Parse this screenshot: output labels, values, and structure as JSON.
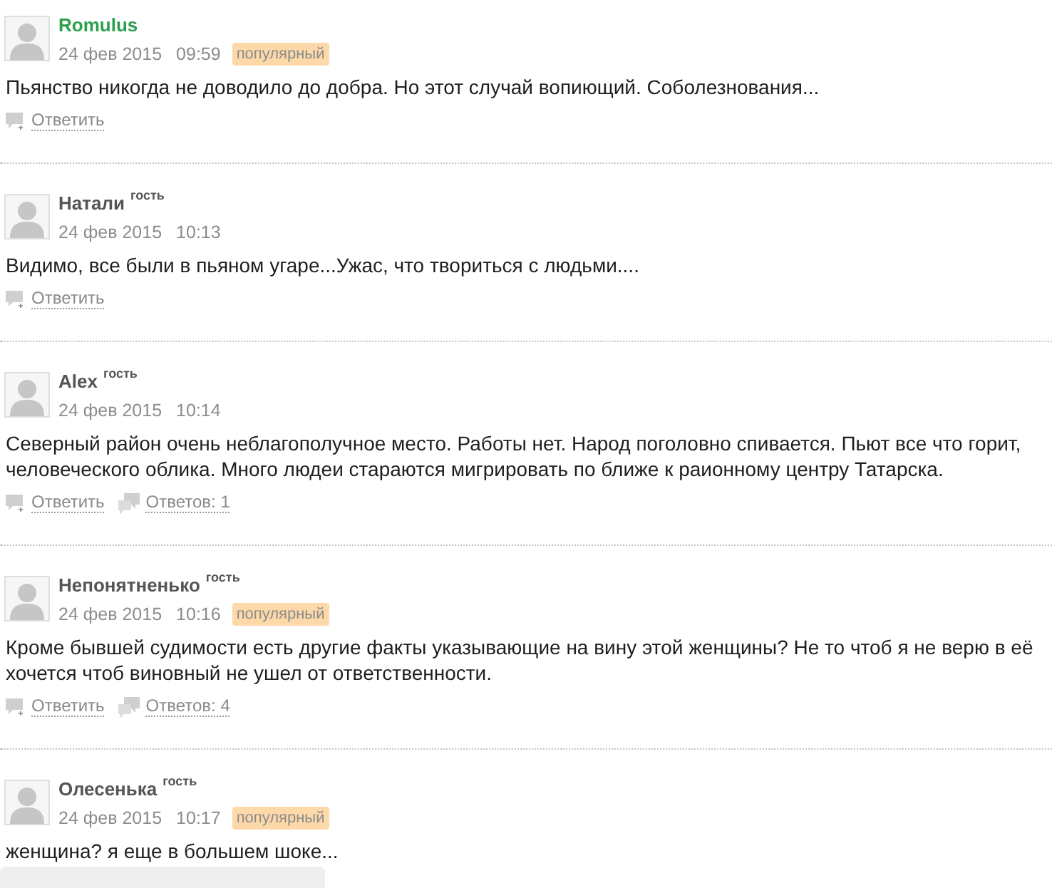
{
  "comments": [
    {
      "author": {
        "name": "Romulus",
        "kind": "member"
      },
      "date": "24 фев 2015",
      "time": "09:59",
      "badge": "популярный",
      "lines": [
        "Пьянство никогда не доводило до добра. Но этот случай вопиющий. Соболезнования..."
      ],
      "actions": [
        {
          "kind": "reply",
          "label": "Ответить"
        }
      ]
    },
    {
      "author": {
        "name": "Натали",
        "kind": "guest",
        "guest_label": "гость"
      },
      "date": "24 фев 2015",
      "time": "10:13",
      "lines": [
        "Видимо, все были в пьяном угаре...Ужас, что твориться с людьми...."
      ],
      "actions": [
        {
          "kind": "reply",
          "label": "Ответить"
        }
      ]
    },
    {
      "author": {
        "name": "Alex",
        "kind": "guest",
        "guest_label": "гость"
      },
      "date": "24 фев 2015",
      "time": "10:14",
      "lines": [
        "Северный район очень неблагополучное место. Работы нет. Народ поголовно спивается. Пьют все что горит,",
        "человеческого облика. Много людеи стараются мигрировать по ближе к раионному центру Татарска."
      ],
      "actions": [
        {
          "kind": "reply",
          "label": "Ответить"
        },
        {
          "kind": "replies",
          "label": "Ответов: 1"
        }
      ]
    },
    {
      "author": {
        "name": "Непонятненько",
        "kind": "guest",
        "guest_label": "гость"
      },
      "date": "24 фев 2015",
      "time": "10:16",
      "badge": "популярный",
      "lines": [
        "Кроме бывшей судимости есть другие факты указывающие на вину этой женщины? Не то чтоб я не верю в её",
        "хочется чтоб виновный не ушел от ответственности."
      ],
      "actions": [
        {
          "kind": "reply",
          "label": "Ответить"
        },
        {
          "kind": "replies",
          "label": "Ответов: 4"
        }
      ]
    },
    {
      "author": {
        "name": "Олесенька",
        "kind": "guest",
        "guest_label": "гость"
      },
      "date": "24 фев 2015",
      "time": "10:17",
      "badge": "популярный",
      "lines": [
        "женщина? я еще в большем шоке..."
      ]
    }
  ]
}
